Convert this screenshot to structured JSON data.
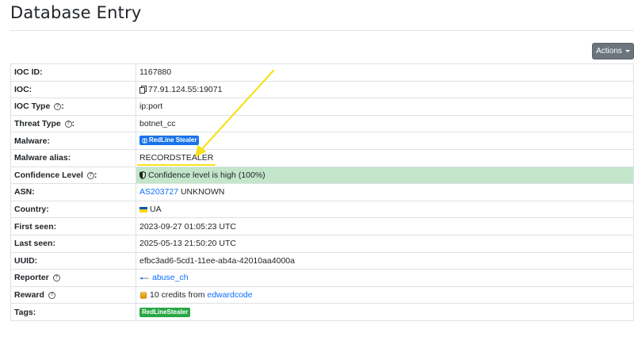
{
  "page": {
    "title": "Database Entry",
    "actions_label": "Actions"
  },
  "entry": {
    "ioc_id": {
      "label": "IOC ID:",
      "value": "1167880"
    },
    "ioc": {
      "label": "IOC:",
      "value": "77.91.124.55:19071"
    },
    "ioc_type": {
      "label": "IOC Type",
      "value": "ip:port"
    },
    "threat_type": {
      "label": "Threat Type",
      "value": "botnet_cc"
    },
    "malware": {
      "label": "Malware:",
      "value": "RedLine Stealer"
    },
    "malware_alias": {
      "label": "Malware alias:",
      "value": "RECORDSTEALER"
    },
    "confidence": {
      "label": "Confidence Level",
      "value": "Confidence level is high (100%)"
    },
    "asn": {
      "label": "ASN:",
      "link": "AS203727",
      "value": "UNKNOWN"
    },
    "country": {
      "label": "Country:",
      "value": "UA"
    },
    "first_seen": {
      "label": "First seen:",
      "value": "2023-09-27 01:05:23 UTC"
    },
    "last_seen": {
      "label": "Last seen:",
      "value": "2025-05-13 21:50:20 UTC"
    },
    "uuid": {
      "label": "UUID:",
      "value": "efbc3ad6-5cd1-11ee-ab4a-42010aa4000a"
    },
    "reporter": {
      "label": "Reporter",
      "value": "abuse_ch"
    },
    "reward": {
      "label": "Reward",
      "text": "10 credits from",
      "link": "edwardcode"
    },
    "tags": {
      "label": "Tags:",
      "value": "RedLineStealer"
    }
  },
  "help_glyph": "?",
  "colors": {
    "badge_blue": "#1a73e8",
    "badge_green": "#28a745",
    "success_row": "#c3e6cb",
    "link": "#0d6efd",
    "annotation": "#f7e11c"
  },
  "icons": [
    "copy-icon",
    "info-icon",
    "malware-icon",
    "shield-icon",
    "ua-flag-icon",
    "reporter-icon",
    "coins-icon",
    "annotation-arrow"
  ]
}
